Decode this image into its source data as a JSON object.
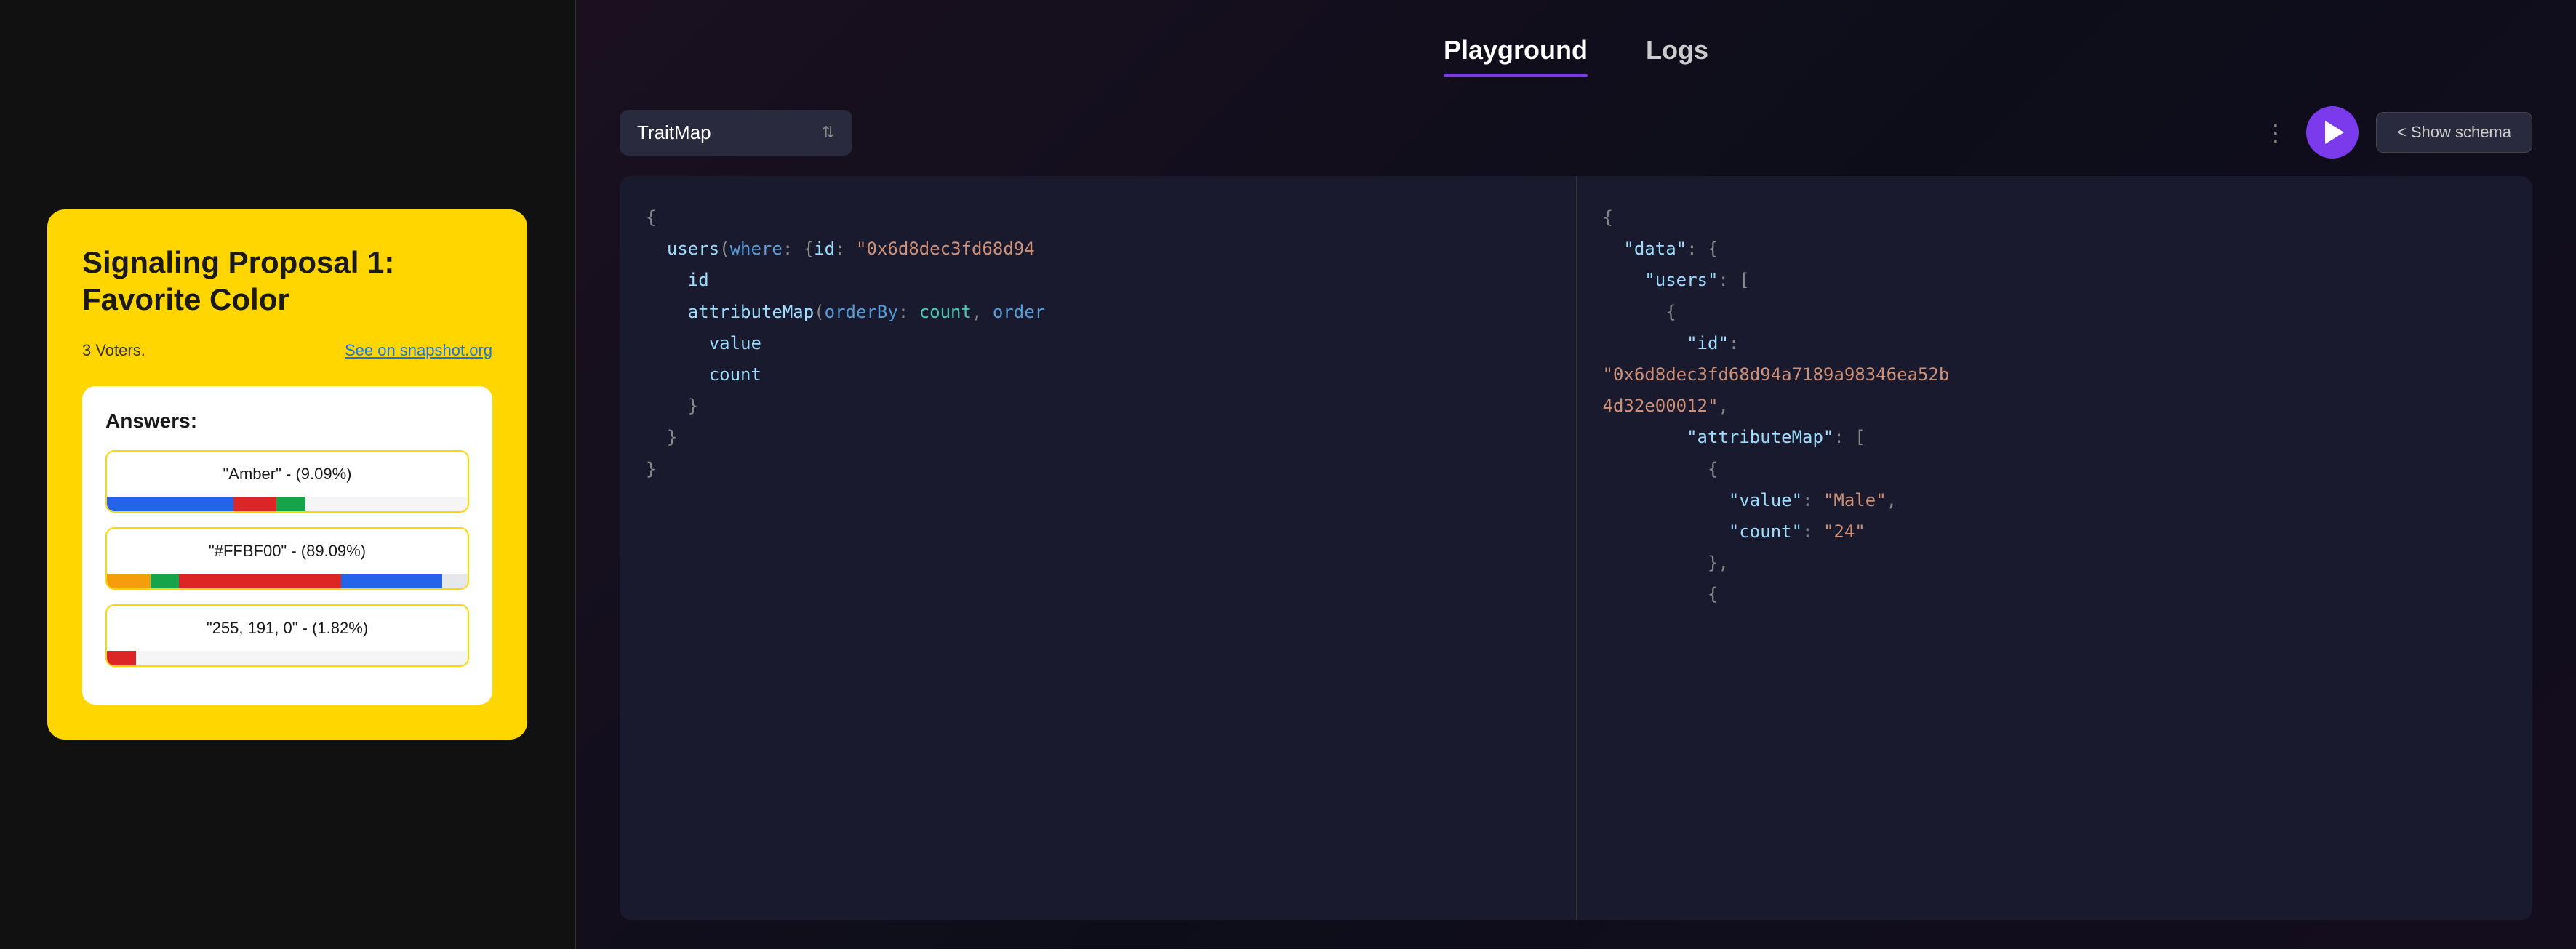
{
  "left": {
    "proposal": {
      "title": "Signaling Proposal 1: Favorite Color",
      "voters_label": "3 Voters.",
      "snapshot_link_label": "See on snapshot.org",
      "answers_label": "Answers:",
      "answers": [
        {
          "label": "\"Amber\" - (9.09%)",
          "bars": [
            {
              "color": "#2563eb",
              "width": 35
            },
            {
              "color": "#dc2626",
              "width": 12
            },
            {
              "color": "#16a34a",
              "width": 8
            }
          ]
        },
        {
          "label": "\"#FFBF00\" - (89.09%)",
          "bars": [
            {
              "color": "#f59e0b",
              "width": 12
            },
            {
              "color": "#16a34a",
              "width": 8
            },
            {
              "color": "#dc2626",
              "width": 45
            },
            {
              "color": "#2563eb",
              "width": 28
            },
            {
              "color": "#e5e7eb",
              "width": 7
            }
          ]
        },
        {
          "label": "\"255, 191, 0\" - (1.82%)",
          "bars": [
            {
              "color": "#dc2626",
              "width": 8
            }
          ]
        }
      ]
    }
  },
  "right": {
    "tabs": [
      {
        "label": "Playground",
        "active": true
      },
      {
        "label": "Logs",
        "active": false
      }
    ],
    "toolbar": {
      "selector_label": "TraitMap",
      "dots": "⋮",
      "run_label": "",
      "show_schema_label": "< Show schema"
    },
    "query_code": "{\n  users(where: {id: \"0x6d8dec3fd68d94\n    id\n    attributeMap(orderBy: count, order\n      value\n      count\n    }\n  }\n}",
    "result_code": "{\n  \"data\": {\n    \"users\": [\n      {\n        \"id\":\n\"0x6d8dec3fd68d94a7189a98346ea52b\n4d32e00012\",\n        \"attributeMap\": [\n          {\n            \"value\": \"Male\",\n            \"count\": \"24\"\n          },\n          {"
  }
}
